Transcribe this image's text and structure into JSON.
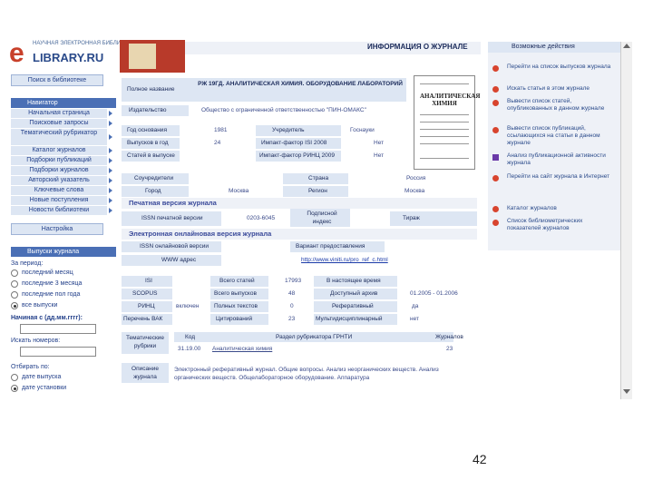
{
  "logo": {
    "letter": "e",
    "tagline": "НАУЧНАЯ ЭЛЕКТРОННАЯ БИБЛИОТЕКА",
    "name": "LIBRARY.RU"
  },
  "sidebar": {
    "search_btn": "Поиск в библиотеке",
    "menu_head": "Навигатор",
    "items": [
      "Начальная страница",
      "Поисковые запросы",
      "Тематический рубрикатор",
      "Каталог журналов",
      "Подборки публикаций",
      "Подборки журналов",
      "Авторский указатель",
      "Ключевые слова",
      "Новые поступления",
      "Новости библиотеки"
    ],
    "settings_btn": "Настройка",
    "issues_head": "Выпуски журнала",
    "period_label": "За период:",
    "period_options": [
      "последний месяц",
      "последние 3 месяца",
      "последние пол года",
      "все выпуски"
    ],
    "from_label": "Начиная с (дд.мм.гггг):",
    "count_label": "Искать номеров:",
    "sort_label": "Отбирать по:",
    "sort_options": [
      "дате выпуска",
      "дате установки"
    ]
  },
  "main": {
    "banner_title": "ИНФОРМАЦИЯ О ЖУРНАЛЕ",
    "full_name_label": "Полное название",
    "full_name": "РЖ 19ГД. АНАЛИТИЧЕСКАЯ ХИМИЯ. ОБОРУДОВАНИЕ ЛАБОРАТОРИЙ",
    "publisher_label": "Издательство",
    "publisher": "Общество с ограниченной ответственностью \"ПИН-ОМАКС\"",
    "year_label": "Год основания",
    "year": "1981",
    "founder_label": "Учредитель",
    "founder": "Госнауки",
    "issues_label": "Выпусков в год",
    "issues": "24",
    "if_label": "Импакт-фактор ISI 2008",
    "if_val": "Нет",
    "articles_label": "Статей в выпуске",
    "ifr_label": "Импакт-фактор РИНЦ 2009",
    "ifr_val": "Нет",
    "founders_label": "Соучредители",
    "country_label": "Страна",
    "country": "Россия",
    "city_label": "Город",
    "city": "Москва",
    "region_label": "Регион",
    "region": "Москва",
    "print_section": "Печатная версия журнала",
    "issn_label": "ISSN печатной версии",
    "issn": "0203-6045",
    "index_label": "Подписной индекс",
    "tirazh_label": "Тираж",
    "online_section": "Электронная онлайновая версия журнала",
    "issn_online_label": "ISSN онлайновой версии",
    "access_label": "Вариант предоставления",
    "www_label": "WWW адрес",
    "www": "http://www.viniti.ru/pro_ref_c.html",
    "isi_label": "ISI",
    "total_articles_label": "Всего статей",
    "total_articles": "17993",
    "current_label": "В настоящее время",
    "scopus_label": "SCOPUS",
    "total_issues_label": "Всего выпусков",
    "total_issues": "48",
    "access_period_label": "Доступный архив",
    "access_period": "01.2005 - 01.2006",
    "rinc_label": "РИНЦ",
    "rinc": "включен",
    "fulltext_label": "Полных текстов",
    "fulltext": "0",
    "refereed_label": "Реферативный",
    "refereed": "да",
    "vak_label": "Перечень ВАК",
    "citations_label": "Цитирований",
    "citations": "23",
    "multi_label": "Мультидисциплинарный",
    "multi": "нет",
    "rubric_label": "Тематические рубрики",
    "rubric_code_head": "Код",
    "rubric_name_head": "Раздел рубрикатора ГРНТИ",
    "rubric_journals_head": "Журналов",
    "rubric_code": "31.19.00",
    "rubric_name": "Аналитическая химия",
    "rubric_count": "23",
    "desc_label": "Описание журнала",
    "desc": "Электронный реферативный журнал. Общие вопросы. Анализ неорганических веществ. Анализ органических веществ. Общелабораторное оборудование. Аппаратура"
  },
  "cover": {
    "title": "АНАЛИТИЧЕСКАЯ ХИМИЯ"
  },
  "right": {
    "title": "Возможные действия",
    "actions": [
      "Перейти на список выпусков журнала",
      "Искать статьи в этом журнале",
      "Вывести список статей, опубликованных в данном журнале",
      "Вывести список публикаций, ссылающихся на статьи в данном журнале",
      "Анализ публикационной активности журнала",
      "Перейти на сайт журнала в Интернет",
      "Каталог журналов",
      "Список библиометрических показателей журналов"
    ]
  },
  "page_number": "42"
}
